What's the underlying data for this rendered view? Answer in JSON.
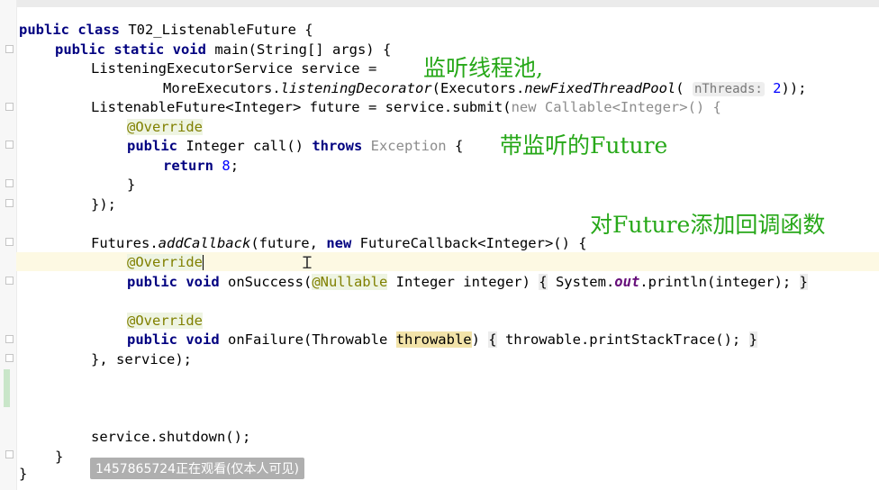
{
  "editor": {
    "lines": {
      "l1_kw": "public class",
      "l1_rest": " T02_ListenableFuture {",
      "l2_kw": "public static void",
      "l2_rest": " main(String[] args) {",
      "l3": "ListeningExecutorService service =",
      "l4_a": "MoreExecutors.",
      "l4_b": "listeningDecorator",
      "l4_c": "(Executors.",
      "l4_d": "newFixedThreadPool",
      "l4_e": "( ",
      "l4_hint": "nThreads:",
      "l4_num": "2",
      "l4_f": "));",
      "l5_a": "ListenableFuture<Integer> future = service.submit(",
      "l5_new": "new",
      "l5_b": " Callable<Integer>() {",
      "l6": "@Override",
      "l7_kw": "public",
      "l7_a": " Integer call() ",
      "l7_throws": "throws",
      "l7_b": " Exception ",
      "l7_c": "{",
      "l8_kw": "return",
      "l8_num": "8",
      "l8_rest": ";",
      "l9": "}",
      "l10": "});",
      "l12_a": "Futures.",
      "l12_b": "addCallback",
      "l12_c": "(future, ",
      "l12_new": "new",
      "l12_d": " FutureCallback<Integer>() {",
      "l13": "@Override",
      "l14_kw": "public void",
      "l14_a": " onSuccess(",
      "l14_ann": "@Nullable",
      "l14_b": " Integer integer) ",
      "l14_c": "{",
      "l14_d": " System.",
      "l14_out": "out",
      "l14_e": ".println(integer); ",
      "l14_f": "}",
      "l16": "@Override",
      "l17_kw": "public void",
      "l17_a": " onFailure(Throwable ",
      "l17_hl": "throwable",
      "l17_b": ") ",
      "l17_c": "{",
      "l17_d": " throwable.printStackTrace(); ",
      "l17_e": "}",
      "l18": "}, service);",
      "l22": "service.shutdown();",
      "l23": "}",
      "l24": "}"
    }
  },
  "annotations": {
    "note1": "监听线程池,",
    "note2": "带监听的Future",
    "note3": "对Future添加回调函数"
  },
  "watermark": "1457865724正在观看(仅本人可见)",
  "colors": {
    "keyword": "#000080",
    "annotation": "#808000",
    "note": "#27a819",
    "number": "#0000ff"
  }
}
